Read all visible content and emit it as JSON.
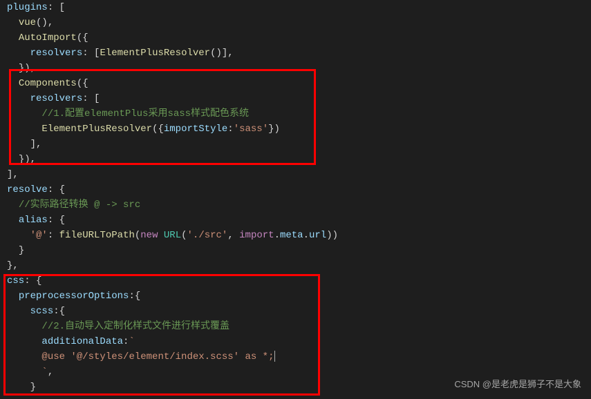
{
  "code": {
    "l1": {
      "a": "plugins",
      "b": ": ["
    },
    "l2": {
      "a": "vue",
      "b": "(),"
    },
    "l3": {
      "a": "AutoImport",
      "b": "({"
    },
    "l4": {
      "a": "resolvers",
      "b": ": [",
      "c": "ElementPlusResolver",
      "d": "()],"
    },
    "l5": {
      "a": "}),"
    },
    "l6": {
      "a": "Components",
      "b": "({"
    },
    "l7": {
      "a": "resolvers",
      "b": ": ["
    },
    "l8": {
      "a": "//1.配置elementPlus采用sass样式配色系统"
    },
    "l9": {
      "a": "ElementPlusResolver",
      "b": "({",
      "c": "importStyle",
      "d": ":",
      "e": "'sass'",
      "f": "})"
    },
    "l10": {
      "a": "],"
    },
    "l11": {
      "a": "}),"
    },
    "l12": {
      "a": "],"
    },
    "l13": {
      "a": "resolve",
      "b": ": {"
    },
    "l14": {
      "a": "//实际路径转换 @ -> src"
    },
    "l15": {
      "a": "alias",
      "b": ": {"
    },
    "l16": {
      "a": "'@'",
      "b": ": ",
      "c": "fileURLToPath",
      "d": "(",
      "e": "new",
      "f": " ",
      "g": "URL",
      "h": "(",
      "i": "'./src'",
      "j": ", ",
      "k": "import",
      "l": ".",
      "m": "meta",
      "n": ".",
      "o": "url",
      "p": "))"
    },
    "l17": {
      "a": "}"
    },
    "l18": {
      "a": "},"
    },
    "l19": {
      "a": "css",
      "b": ": {"
    },
    "l20": {
      "a": "preprocessorOptions",
      "b": ":{"
    },
    "l21": {
      "a": "scss",
      "b": ":{"
    },
    "l22": {
      "a": "//2.自动导入定制化样式文件进行样式覆盖"
    },
    "l23": {
      "a": "additionalData",
      "b": ":",
      "c": "`"
    },
    "l24": {
      "a": "@use '@/styles/element/index.scss' as *;"
    },
    "l25": {
      "a": "`",
      "b": ","
    },
    "l26": {
      "a": "}"
    }
  },
  "watermark": "CSDN @是老虎是狮子不是大象"
}
